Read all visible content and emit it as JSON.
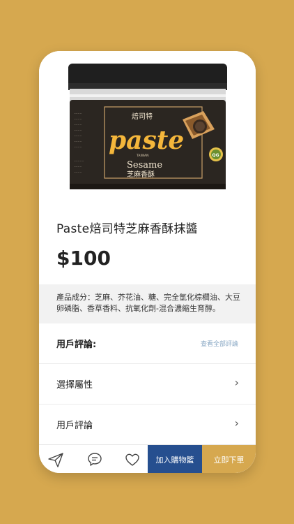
{
  "product": {
    "brand_cn": "焙司特",
    "logo_text": "paste",
    "logo_sub": "TAIWAN",
    "flavor_en": "Sesame",
    "flavor_cn": "芝麻香酥",
    "title": "Paste焙司特芝麻香酥抹醬",
    "price": "$100",
    "ingredients": "產品成分：芝麻、芥花油、糖、完全氫化棕櫚油、大豆卵磷脂、香草香料、抗氧化劑-混合濃縮生育醇。"
  },
  "sections": {
    "reviews_header": "用戶評論:",
    "view_all_reviews": "查看全部評論",
    "select_attributes": "選擇屬性",
    "user_reviews": "用戶評論"
  },
  "bottom_bar": {
    "icons": [
      "send-icon",
      "chat-icon",
      "heart-icon"
    ],
    "add_to_cart": "加入購物籃",
    "order_now": "立即下單"
  },
  "colors": {
    "background": "#d6a84f",
    "cart_button": "#264f8f",
    "order_button": "#d6a84f"
  }
}
